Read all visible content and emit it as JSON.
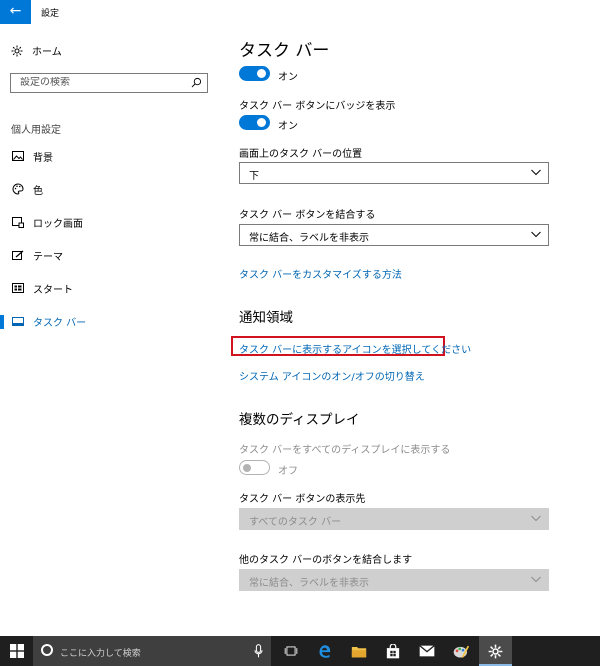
{
  "window": {
    "back_glyph": "←",
    "title": "設定"
  },
  "sidebar": {
    "home": {
      "icon": "gear-icon",
      "label": "ホーム"
    },
    "search": {
      "placeholder": "設定の検索",
      "icon": "search-icon"
    },
    "section": "個人用設定",
    "items": [
      {
        "icon": "picture-icon",
        "label": "背景",
        "selected": false
      },
      {
        "icon": "palette-icon",
        "label": "色",
        "selected": false
      },
      {
        "icon": "lock-screen-icon",
        "label": "ロック画面",
        "selected": false
      },
      {
        "icon": "theme-icon",
        "label": "テーマ",
        "selected": false
      },
      {
        "icon": "start-icon",
        "label": "スタート",
        "selected": false
      },
      {
        "icon": "taskbar-icon",
        "label": "タスク バー",
        "selected": true
      }
    ]
  },
  "main": {
    "title": "タスク バー",
    "toggle1": {
      "state": "オン",
      "on": true
    },
    "badge_label": "タスク バー ボタンにバッジを表示",
    "toggle2": {
      "state": "オン",
      "on": true
    },
    "position_label": "画面上のタスク バーの位置",
    "position_value": "下",
    "combine_label": "タスク バー ボタンを結合する",
    "combine_value": "常に結合、ラベルを非表示",
    "customize_link": "タスク バーをカスタマイズする方法",
    "notification": {
      "heading": "通知領域",
      "select_icons_link": "タスク バーに表示するアイコンを選択してください",
      "system_icons_link": "システム アイコンのオン/オフの切り替え"
    },
    "multi_display": {
      "heading": "複数のディスプレイ",
      "show_all_label": "タスク バーをすべてのディスプレイに表示する",
      "toggle": {
        "state": "オフ",
        "on": false
      },
      "buttons_on_label": "タスク バー ボタンの表示先",
      "buttons_on_value": "すべてのタスク バー",
      "combine_other_label": "他のタスク バーのボタンを結合します",
      "combine_other_value": "常に結合、ラベルを非表示"
    }
  },
  "taskbar": {
    "search_text": "ここに入力して検索",
    "apps": [
      "task-view-icon",
      "edge-icon",
      "file-explorer-icon",
      "store-icon",
      "mail-icon",
      "paint-icon",
      "settings-icon"
    ],
    "highlight_color": "#d0131f",
    "accent_color": "#0078d7"
  }
}
